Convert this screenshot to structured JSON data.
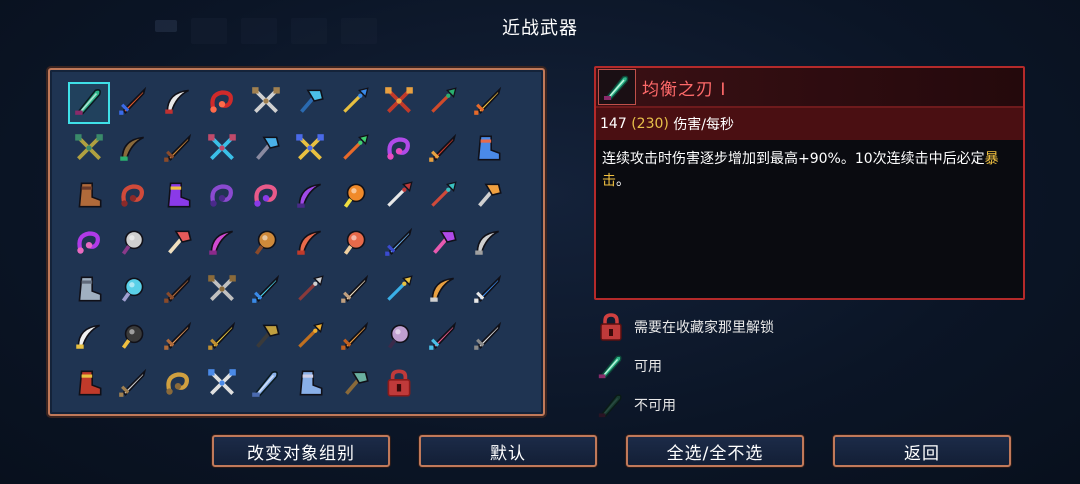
{
  "title": "近战武器",
  "detail": {
    "name": "均衡之刃 I",
    "dps_value": "147",
    "dps_alt": "230",
    "dps_suffix": "伤害/每秒",
    "desc_part1": "连续攻击时伤害逐步增加到最高+90%。10次连续击中后必定",
    "desc_highlight": "暴击",
    "desc_part2": "。"
  },
  "legend": [
    {
      "icon": "lock-icon",
      "label": "需要在收藏家那里解锁"
    },
    {
      "icon": "blade-icon-available",
      "label": "可用"
    },
    {
      "icon": "blade-icon-unavailable",
      "label": "不可用"
    }
  ],
  "buttons": {
    "change_group": "改变对象组别",
    "default": "默认",
    "select_all": "全选/全不选",
    "back": "返回"
  },
  "weapons": [
    {
      "name": "balanced-blade-icon",
      "c1": "#2fb58a",
      "c2": "#8a2a6a",
      "shape": "blade",
      "selected": true
    },
    {
      "name": "fire-sword-icon",
      "c1": "#e85a2a",
      "c2": "#3a6ae8",
      "shape": "sword"
    },
    {
      "name": "curved-sword-icon",
      "c1": "#e8e8e8",
      "c2": "#c03030",
      "shape": "scim"
    },
    {
      "name": "whip-red-icon",
      "c1": "#d02a2a",
      "c2": "#ff6a4a",
      "shape": "swirl"
    },
    {
      "name": "twin-daggers-icon",
      "c1": "#d0d0d0",
      "c2": "#a08050",
      "shape": "cross"
    },
    {
      "name": "ice-hammer-icon",
      "c1": "#4ac0e8",
      "c2": "#2a6ab0",
      "shape": "hammer"
    },
    {
      "name": "blue-shovel-icon",
      "c1": "#3a8ae8",
      "c2": "#e8c040",
      "shape": "spear"
    },
    {
      "name": "thorn-bow-icon",
      "c1": "#c03a2a",
      "c2": "#e8a040",
      "shape": "cross"
    },
    {
      "name": "leaf-spear-icon",
      "c1": "#2ab070",
      "c2": "#d04a2a",
      "shape": "spear"
    },
    {
      "name": "gold-flame-sword-icon",
      "c1": "#f0c040",
      "c2": "#e86a2a",
      "shape": "sword"
    },
    {
      "name": "vine-crossbow-icon",
      "c1": "#b0a040",
      "c2": "#3a8a6a",
      "shape": "cross"
    },
    {
      "name": "wood-bow-icon",
      "c1": "#8a6a3a",
      "c2": "#2ab070",
      "shape": "scim"
    },
    {
      "name": "bronze-sword-icon",
      "c1": "#d08a3a",
      "c2": "#8a4a2a",
      "shape": "sword"
    },
    {
      "name": "twin-cyan-blades-icon",
      "c1": "#3ac0e8",
      "c2": "#c04a6a",
      "shape": "cross"
    },
    {
      "name": "cyan-axe-icon",
      "c1": "#4ab0e8",
      "c2": "#8a8aa0",
      "shape": "hammer"
    },
    {
      "name": "golden-crossbow-icon",
      "c1": "#e8c040",
      "c2": "#4a6ae8",
      "shape": "cross"
    },
    {
      "name": "green-rapier-icon",
      "c1": "#40d070",
      "c2": "#e86a2a",
      "shape": "spear"
    },
    {
      "name": "purple-claw-icon",
      "c1": "#b04ae8",
      "c2": "#e84ac0",
      "shape": "swirl"
    },
    {
      "name": "red-shield-sword-icon",
      "c1": "#d03a2a",
      "c2": "#e8a040",
      "shape": "sword"
    },
    {
      "name": "blue-boot-icon",
      "c1": "#4a8ae8",
      "c2": "#e86a4a",
      "shape": "boot"
    },
    {
      "name": "brown-boot-icon",
      "c1": "#b06a3a",
      "c2": "#6a3a2a",
      "shape": "boot"
    },
    {
      "name": "red-fan-icon",
      "c1": "#d04a3a",
      "c2": "#8a2a2a",
      "shape": "swirl"
    },
    {
      "name": "purple-gauntlet-icon",
      "c1": "#8a3ae8",
      "c2": "#f0c040",
      "shape": "boot"
    },
    {
      "name": "purple-whip-icon",
      "c1": "#8a4ad0",
      "c2": "#4a2a8a",
      "shape": "swirl"
    },
    {
      "name": "pink-whip-icon",
      "c1": "#e85a8a",
      "c2": "#8a3ae8",
      "shape": "swirl"
    },
    {
      "name": "violet-scythe-icon",
      "c1": "#a04ae8",
      "c2": "#4a2a8a",
      "shape": "scim"
    },
    {
      "name": "fire-orb-icon",
      "c1": "#f08a2a",
      "c2": "#f0e040",
      "shape": "orb"
    },
    {
      "name": "red-spear-icon",
      "c1": "#c03a3a",
      "c2": "#e8e8e8",
      "shape": "spear"
    },
    {
      "name": "cyan-trident-icon",
      "c1": "#3ac0c0",
      "c2": "#d04a3a",
      "shape": "spear"
    },
    {
      "name": "orange-pickaxe-icon",
      "c1": "#f0a040",
      "c2": "#d0d0d0",
      "shape": "hammer"
    },
    {
      "name": "purple-tentacle-icon",
      "c1": "#b03ae8",
      "c2": "#e86ac0",
      "shape": "swirl"
    },
    {
      "name": "frying-pan-icon",
      "c1": "#d0d0d0",
      "c2": "#8a3a8a",
      "shape": "orb"
    },
    {
      "name": "spotted-cleaver-icon",
      "c1": "#e85a5a",
      "c2": "#f0e0c0",
      "shape": "hammer"
    },
    {
      "name": "pink-scythe-icon",
      "c1": "#d04ad0",
      "c2": "#8a2a8a",
      "shape": "scim"
    },
    {
      "name": "lute-icon",
      "c1": "#d08a3a",
      "c2": "#8a4a2a",
      "shape": "orb"
    },
    {
      "name": "red-cane-icon",
      "c1": "#e86a4a",
      "c2": "#c03a2a",
      "shape": "scim"
    },
    {
      "name": "ham-club-icon",
      "c1": "#e86a4a",
      "c2": "#f0d0a0",
      "shape": "orb"
    },
    {
      "name": "blue-knife-icon",
      "c1": "#6ab0e8",
      "c2": "#3a4ad0",
      "shape": "sword"
    },
    {
      "name": "purple-battery-icon",
      "c1": "#b04ae8",
      "c2": "#e85ab0",
      "shape": "hammer"
    },
    {
      "name": "curved-dagger-icon",
      "c1": "#d0d0d0",
      "c2": "#a0a0a0",
      "shape": "scim"
    },
    {
      "name": "tombstone-icon",
      "c1": "#a0b0c0",
      "c2": "#606a7a",
      "shape": "boot"
    },
    {
      "name": "cyan-mace-icon",
      "c1": "#5ad0e8",
      "c2": "#a0a0d0",
      "shape": "orb"
    },
    {
      "name": "wooden-club-icon",
      "c1": "#b06a3a",
      "c2": "#8a4a2a",
      "shape": "sword"
    },
    {
      "name": "crossed-swords-icon",
      "c1": "#c0c0c0",
      "c2": "#8a6a3a",
      "shape": "cross"
    },
    {
      "name": "cyan-longsword-icon",
      "c1": "#4ad0e8",
      "c2": "#3a8ae8",
      "shape": "sword"
    },
    {
      "name": "steel-spear-icon",
      "c1": "#d0d0d0",
      "c2": "#8a3a3a",
      "shape": "spear"
    },
    {
      "name": "bone-club-icon",
      "c1": "#f0e0c0",
      "c2": "#c0a080",
      "shape": "sword"
    },
    {
      "name": "golden-trident-icon",
      "c1": "#e8c040",
      "c2": "#3ab0e8",
      "shape": "spear"
    },
    {
      "name": "hook-hand-icon",
      "c1": "#e8a040",
      "c2": "#d0d0d0",
      "shape": "scim"
    },
    {
      "name": "shark-blade-icon",
      "c1": "#3a8ae8",
      "c2": "#e8e8e8",
      "shape": "sword"
    },
    {
      "name": "crescent-moon-icon",
      "c1": "#f0f0f0",
      "c2": "#e8c040",
      "shape": "scim"
    },
    {
      "name": "spiked-ball-icon",
      "c1": "#3a3a3a",
      "c2": "#f0c040",
      "shape": "orb"
    },
    {
      "name": "wooden-sword-icon",
      "c1": "#e89a5a",
      "c2": "#b06a3a",
      "shape": "sword"
    },
    {
      "name": "golden-sword-icon",
      "c1": "#f0d040",
      "c2": "#c09030",
      "shape": "sword"
    },
    {
      "name": "gold-pickaxe-icon",
      "c1": "#c0a040",
      "c2": "#3a3a3a",
      "shape": "hammer"
    },
    {
      "name": "gold-scepter-icon",
      "c1": "#f0b030",
      "c2": "#c07020",
      "shape": "spear"
    },
    {
      "name": "orange-bat-icon",
      "c1": "#f0a040",
      "c2": "#c06020",
      "shape": "sword"
    },
    {
      "name": "dark-ring-icon",
      "c1": "#c0a0d0",
      "c2": "#3a2a4a",
      "shape": "orb"
    },
    {
      "name": "pink-sword-icon",
      "c1": "#e85a8a",
      "c2": "#4ac0e8",
      "shape": "sword"
    },
    {
      "name": "thin-rapier-icon",
      "c1": "#e0e0e0",
      "c2": "#8a8a8a",
      "shape": "sword"
    },
    {
      "name": "red-book-icon",
      "c1": "#c03a2a",
      "c2": "#e8c040",
      "shape": "boot"
    },
    {
      "name": "short-sword-icon",
      "c1": "#d0d0d0",
      "c2": "#a08050",
      "shape": "sword"
    },
    {
      "name": "golden-whip-icon",
      "c1": "#d0a040",
      "c2": "#8a6a3a",
      "shape": "swirl"
    },
    {
      "name": "twin-bows-icon",
      "c1": "#e0e0e0",
      "c2": "#4a8ae8",
      "shape": "cross"
    },
    {
      "name": "ice-blade-icon",
      "c1": "#8ab0e8",
      "c2": "#4a6ab0",
      "shape": "blade"
    },
    {
      "name": "scroll-icon",
      "c1": "#8ab0e8",
      "c2": "#d0d0e8",
      "shape": "boot"
    },
    {
      "name": "green-axe-icon",
      "c1": "#6ab0a0",
      "c2": "#8a6a3a",
      "shape": "hammer"
    },
    {
      "name": "red-lock-icon",
      "c1": "#c03a3a",
      "c2": "#8a1a1a",
      "shape": "lock"
    }
  ]
}
